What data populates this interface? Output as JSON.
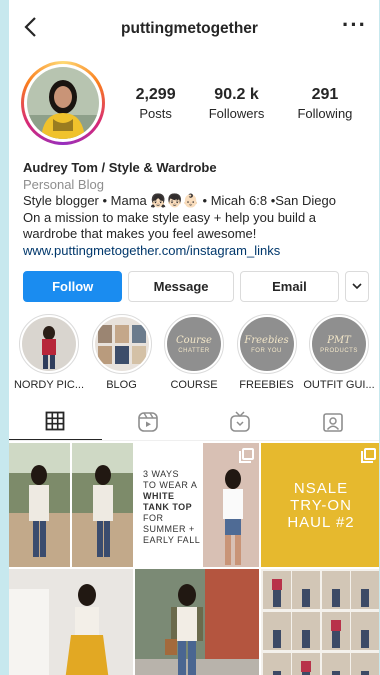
{
  "header": {
    "username": "puttingmetogether",
    "back_icon": "chevron-left-icon",
    "more_icon": "more-horizontal-icon"
  },
  "stats": [
    {
      "value": "2,299",
      "label": "Posts"
    },
    {
      "value": "90.2 k",
      "label": "Followers"
    },
    {
      "value": "291",
      "label": "Following"
    }
  ],
  "bio": {
    "name": "Audrey Tom / Style & Wardrobe",
    "category": "Personal Blog",
    "line1": "Style blogger • Mama 👧🏻👦🏻👶🏻 • Micah 6:8 •San Diego",
    "line2": "On a mission to make style easy + help you build a wardrobe that makes you feel awesome!",
    "link": "www.puttingmetogether.com/instagram_links"
  },
  "actions": {
    "follow": "Follow",
    "message": "Message",
    "email": "Email"
  },
  "highlights": [
    {
      "label": "NORDY PIC...",
      "art": ""
    },
    {
      "label": "BLOG",
      "art": ""
    },
    {
      "label": "COURSE",
      "art_line1": "Course",
      "art_line2": "CHATTER"
    },
    {
      "label": "FREEBIES",
      "art_line1": "Freebies",
      "art_line2": "FOR YOU"
    },
    {
      "label": "OUTFIT GUI...",
      "art_line1": "PMT",
      "art_line2": "PRODUCTS"
    }
  ],
  "tabs": [
    "grid-icon",
    "reels-icon",
    "igtv-icon",
    "tagged-icon"
  ],
  "posts": {
    "text_post": {
      "l1": "3 WAYS",
      "l2": "TO WEAR A",
      "l3": "WHITE",
      "l4": "TANK TOP",
      "l5": "FOR",
      "l6": "SUMMER +",
      "l7": "EARLY FALL"
    },
    "yellow_post": {
      "l1": "NSALE",
      "l2": "TRY-ON",
      "l3": "HAUL #2"
    }
  },
  "colors": {
    "accent": "#1a8cf0",
    "link": "#00376b",
    "background": "#c7e8ee"
  }
}
